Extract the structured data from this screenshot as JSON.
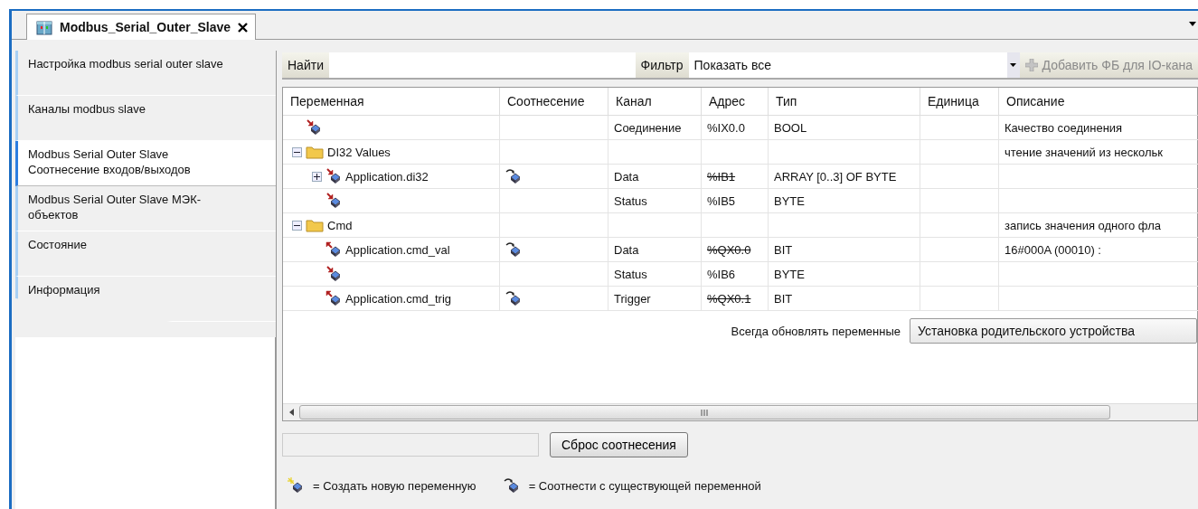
{
  "tab": {
    "title": "Modbus_Serial_Outer_Slave",
    "selected": true
  },
  "sidebar": {
    "items": [
      {
        "label": "Настройка modbus serial outer slave",
        "selected": false
      },
      {
        "label": "Каналы modbus slave",
        "selected": false
      },
      {
        "label": "Modbus Serial Outer Slave Соотнесение входов/выходов",
        "selected": true
      },
      {
        "label": "Modbus Serial Outer Slave МЭК-объектов",
        "selected": false
      },
      {
        "label": "Состояние",
        "selected": false
      },
      {
        "label": "Информация",
        "selected": false
      }
    ]
  },
  "toolbar": {
    "find_label": "Найти",
    "filter_label": "Фильтр",
    "filter_value": "Показать все",
    "add_button": {
      "label": "Добавить ФБ для IO-кана",
      "disabled": true
    }
  },
  "table": {
    "columns": [
      "Переменная",
      "Соотнесение",
      "Канал",
      "Адрес",
      "Тип",
      "Единица",
      "Описание"
    ],
    "rows": [
      {
        "kind": "variable",
        "output": false,
        "mapped": false,
        "channel": "Соединение",
        "address": "%IX0.0",
        "address_struck": false,
        "type": "BOOL",
        "description": "Качество соединения"
      },
      {
        "kind": "folder",
        "name": "DI32 Values",
        "expanded": true,
        "description": "чтение значений из нескольк",
        "children": [
          {
            "kind": "variable",
            "name": "Application.di32",
            "output": false,
            "mapped": true,
            "expanded": false,
            "channel": "Data",
            "address": "%IB1",
            "address_struck": true,
            "type": "ARRAY [0..3] OF BYTE"
          },
          {
            "kind": "variable",
            "output": false,
            "mapped": false,
            "channel": "Status",
            "address": "%IB5",
            "address_struck": false,
            "type": "BYTE"
          }
        ]
      },
      {
        "kind": "folder",
        "name": "Cmd",
        "expanded": true,
        "description": "запись значения одного фла",
        "children": [
          {
            "kind": "variable",
            "name": "Application.cmd_val",
            "output": true,
            "mapped": true,
            "channel": "Data",
            "address": "%QX0.0",
            "address_struck": true,
            "type": "BIT",
            "description": "16#000A (00010) :"
          },
          {
            "kind": "variable",
            "output": false,
            "mapped": false,
            "channel": "Status",
            "address": "%IB6",
            "address_struck": false,
            "type": "BYTE"
          },
          {
            "kind": "variable",
            "name": "Application.cmd_trig",
            "output": true,
            "mapped": true,
            "channel": "Trigger",
            "address": "%QX0.1",
            "address_struck": true,
            "type": "BIT"
          }
        ]
      }
    ]
  },
  "update_option": {
    "label": "Всегда обновлять переменные",
    "value": "Установка родительского устройства"
  },
  "reset_button": "Сброс соотнесения",
  "legend": [
    {
      "kind": "new",
      "text": "= Создать новую переменную"
    },
    {
      "kind": "map",
      "text": "= Соотнести с существующей переменной"
    }
  ]
}
